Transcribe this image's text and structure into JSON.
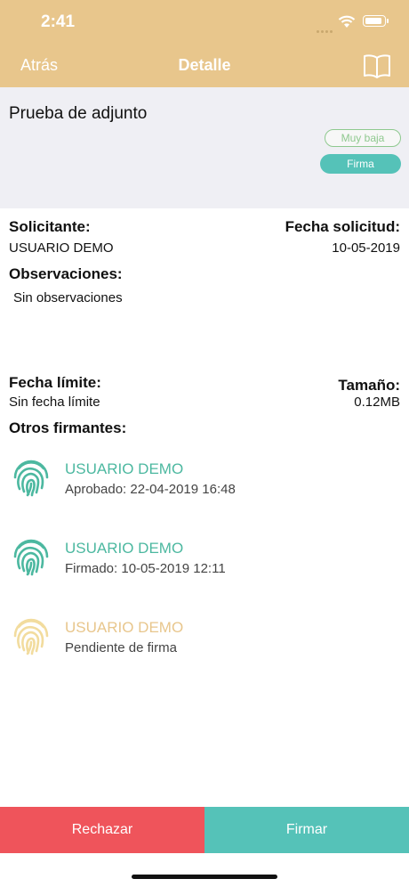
{
  "status_bar": {
    "time": "2:41"
  },
  "nav": {
    "back_label": "Atrás",
    "title": "Detalle",
    "icon": "book-icon"
  },
  "document": {
    "title": "Prueba de adjunto",
    "priority": "Muy baja",
    "type": "Firma"
  },
  "details": {
    "requester_label": "Solicitante:",
    "requester": "USUARIO DEMO",
    "request_date_label": "Fecha solicitud:",
    "request_date": "10-05-2019",
    "observations_label": "Observaciones:",
    "observations": "Sin observaciones",
    "deadline_label": "Fecha límite:",
    "deadline": "Sin fecha límite",
    "size_label": "Tamaño:",
    "size": "0.12MB",
    "other_signers_label": "Otros firmantes:"
  },
  "signers": [
    {
      "name": "USUARIO DEMO",
      "status": "Aprobado: 22-04-2019 16:48",
      "color": "#4cb8a0"
    },
    {
      "name": "USUARIO DEMO",
      "status": "Firmado: 10-05-2019 12:11",
      "color": "#4cb8a0"
    },
    {
      "name": "USUARIO DEMO",
      "status": "Pendiente de firma",
      "color": "#e8c68c"
    }
  ],
  "actions": {
    "reject_label": "Rechazar",
    "sign_label": "Firmar"
  },
  "colors": {
    "header": "#e8c68c",
    "accent": "#55c2b8",
    "reject": "#ef545b",
    "approved": "#4cb8a0",
    "pending": "#e8c68c"
  }
}
